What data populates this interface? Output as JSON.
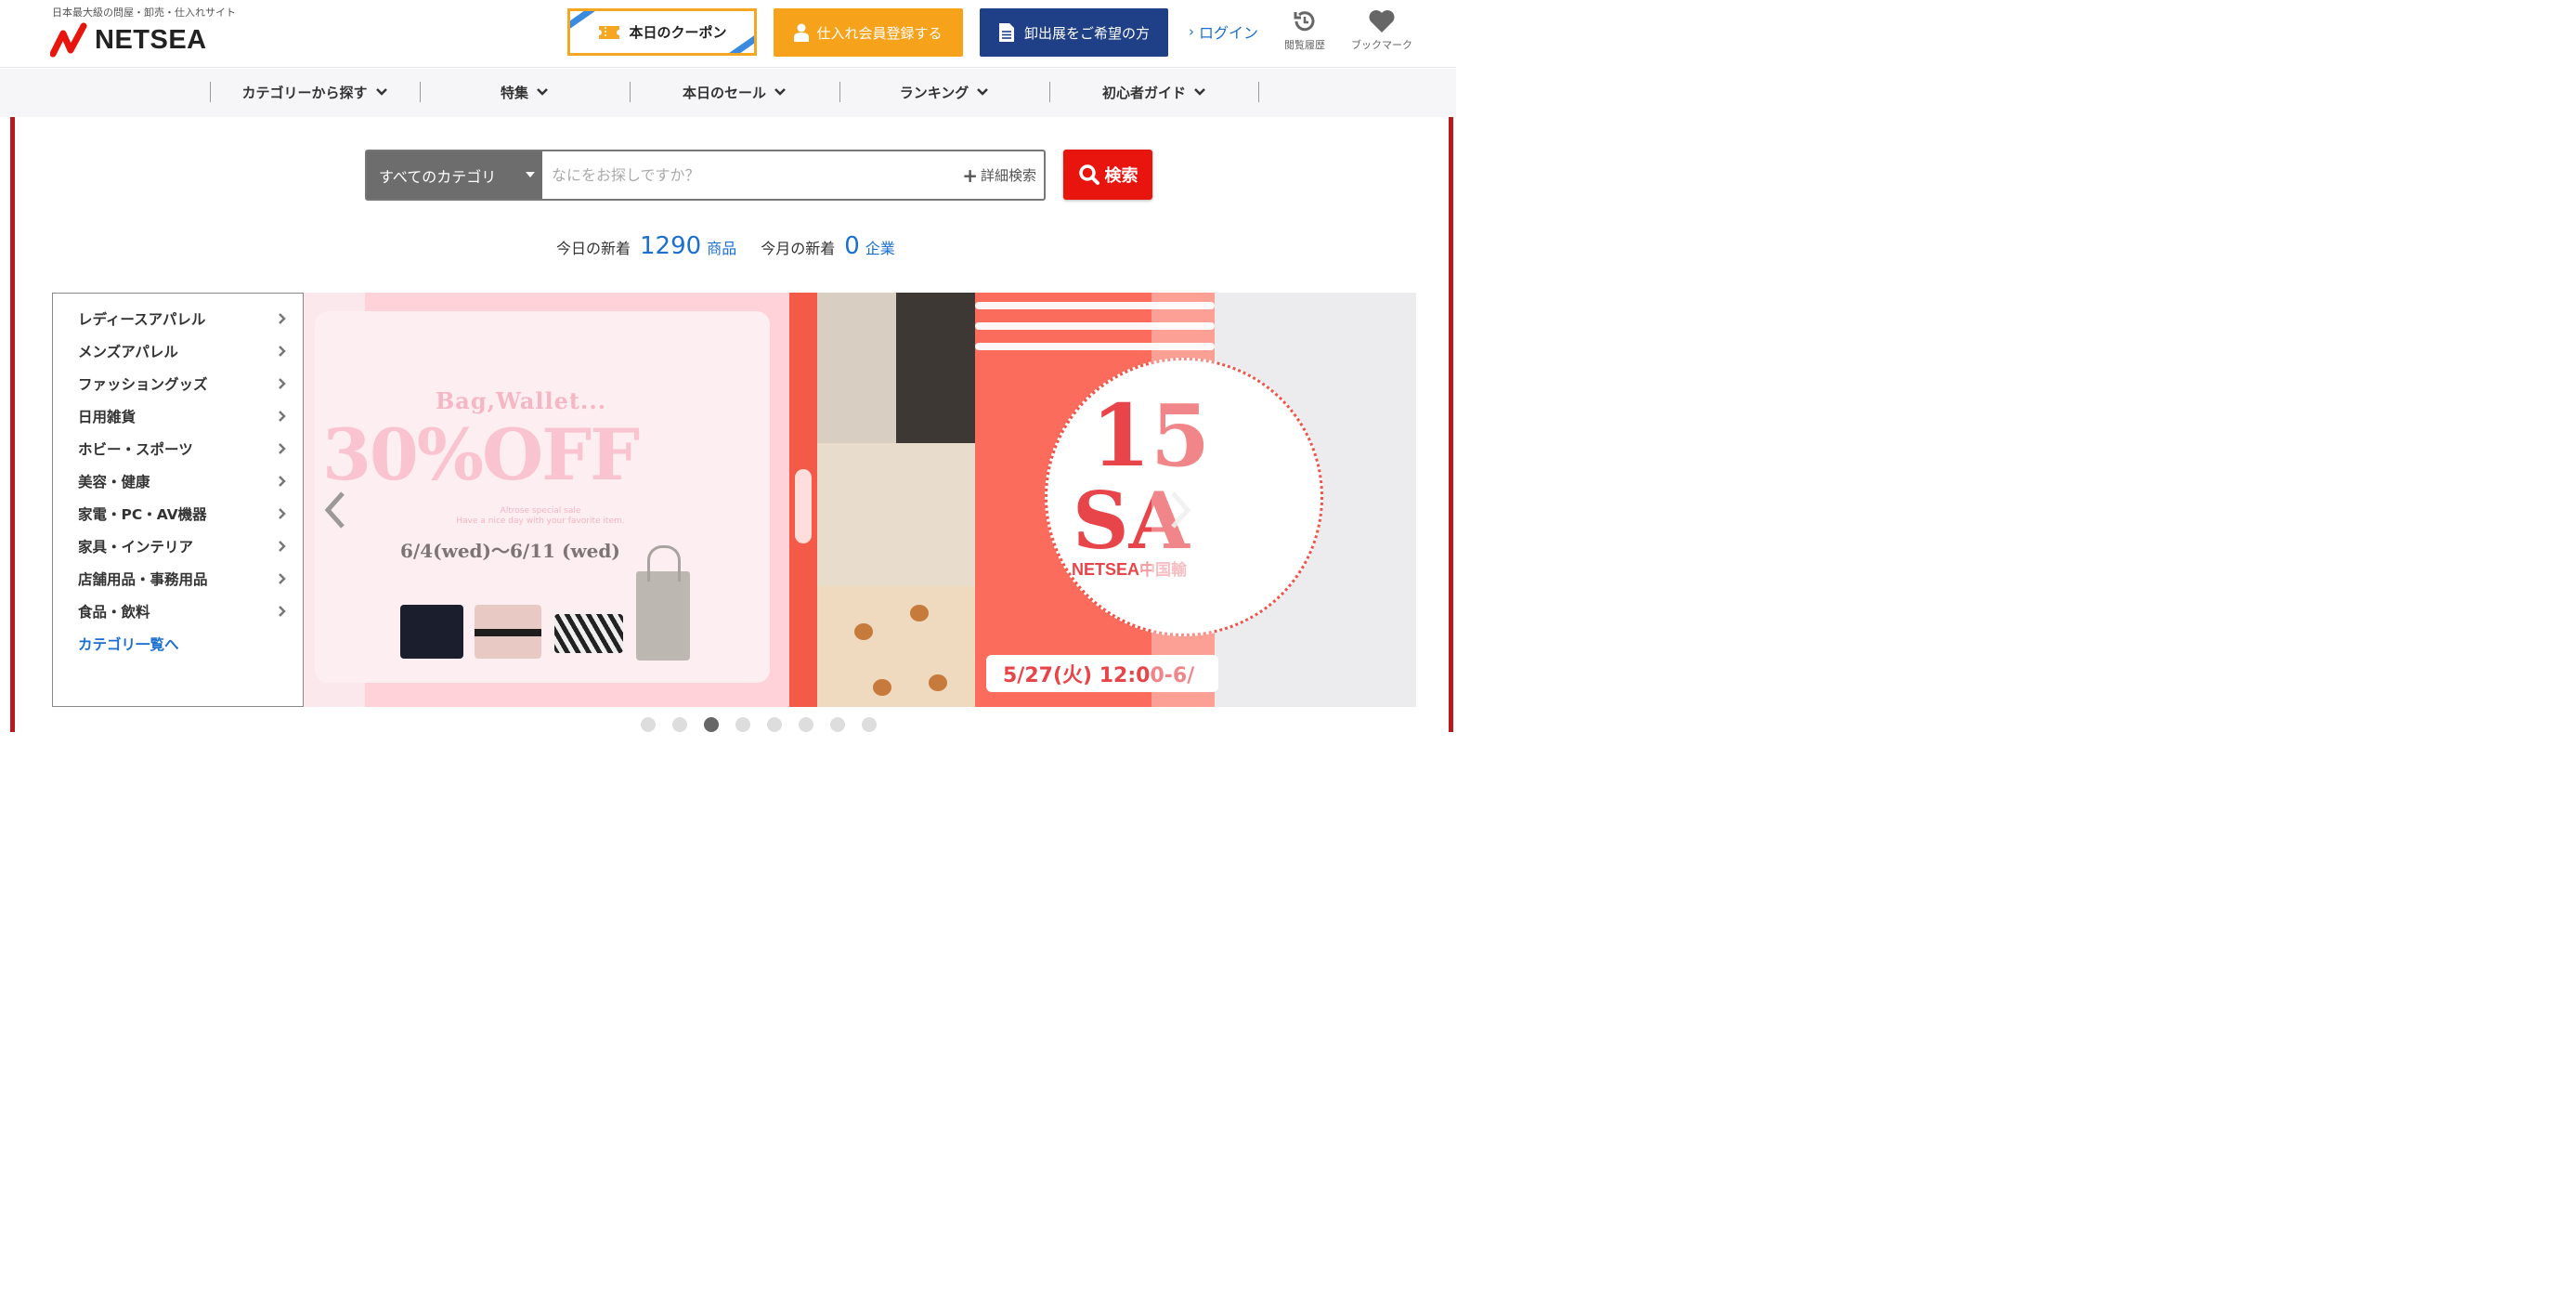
{
  "header": {
    "tagline": "日本最大級の問屋・卸売・仕入れサイト",
    "logo_text": "NETSEA",
    "coupon_label": "本日のクーポン",
    "member_label": "仕入れ会員登録する",
    "exhibit_label": "卸出展をご希望の方",
    "login_label": "ログイン",
    "history_label": "閲覧履歴",
    "bookmark_label": "ブックマーク"
  },
  "colors": {
    "accent_red": "#e8150e",
    "orange": "#f7a21b",
    "navy": "#1f3f87",
    "link_blue": "#1a6fd0",
    "frame_red": "#b8191c"
  },
  "nav": {
    "items": [
      {
        "label": "カテゴリーから探す"
      },
      {
        "label": "特集"
      },
      {
        "label": "本日のセール"
      },
      {
        "label": "ランキング"
      },
      {
        "label": "初心者ガイド"
      }
    ]
  },
  "search": {
    "category_selected": "すべてのカテゴリ",
    "placeholder": "なにをお探しですか？",
    "detail_label": "詳細検索",
    "button_label": "検索"
  },
  "counts": {
    "today_label": "今日の新着",
    "today_value": "1290",
    "today_unit": "商品",
    "month_label": "今月の新着",
    "month_value": "0",
    "month_unit": "企業"
  },
  "categories": {
    "items": [
      {
        "label": "レディースアパレル"
      },
      {
        "label": "メンズアパレル"
      },
      {
        "label": "ファッショングッズ"
      },
      {
        "label": "日用雑貨"
      },
      {
        "label": "ホビー・スポーツ"
      },
      {
        "label": "美容・健康"
      },
      {
        "label": "家電・PC・AV機器"
      },
      {
        "label": "家具・インテリア"
      },
      {
        "label": "店舗用品・事務用品"
      },
      {
        "label": "食品・飲料"
      }
    ],
    "all_label": "カテゴリ一覧へ"
  },
  "carousel": {
    "slide1": {
      "headline_small": "Bag,Wallet...",
      "headline_big": "30%OFF",
      "sub_line1": "Altrose special sale",
      "sub_line2": "Have a nice day with your favorite item.",
      "date": "6/4(wed)〜6/11 (wed)"
    },
    "slide2": {
      "big_line1": "15",
      "big_line2": "SA",
      "brand": "NETSEA",
      "brand_suffix": "中国輸",
      "date": "5/27(火) 12:00-6/"
    },
    "prev_icon": "chevron-left-icon",
    "next_icon": "chevron-right-icon",
    "dot_count": 8,
    "active_dot": 3
  }
}
